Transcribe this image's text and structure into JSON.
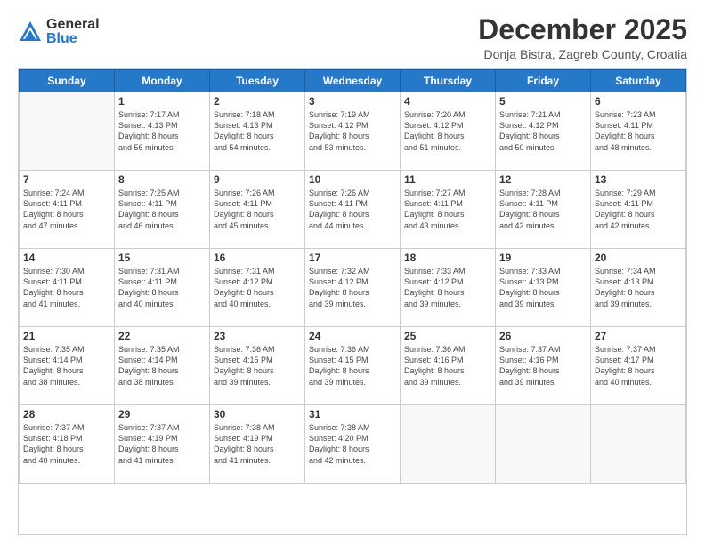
{
  "logo": {
    "general": "General",
    "blue": "Blue"
  },
  "header": {
    "month": "December 2025",
    "location": "Donja Bistra, Zagreb County, Croatia"
  },
  "days": [
    "Sunday",
    "Monday",
    "Tuesday",
    "Wednesday",
    "Thursday",
    "Friday",
    "Saturday"
  ],
  "weeks": [
    [
      {
        "day": "",
        "info": []
      },
      {
        "day": "1",
        "info": [
          "Sunrise: 7:17 AM",
          "Sunset: 4:13 PM",
          "Daylight: 8 hours",
          "and 56 minutes."
        ]
      },
      {
        "day": "2",
        "info": [
          "Sunrise: 7:18 AM",
          "Sunset: 4:13 PM",
          "Daylight: 8 hours",
          "and 54 minutes."
        ]
      },
      {
        "day": "3",
        "info": [
          "Sunrise: 7:19 AM",
          "Sunset: 4:12 PM",
          "Daylight: 8 hours",
          "and 53 minutes."
        ]
      },
      {
        "day": "4",
        "info": [
          "Sunrise: 7:20 AM",
          "Sunset: 4:12 PM",
          "Daylight: 8 hours",
          "and 51 minutes."
        ]
      },
      {
        "day": "5",
        "info": [
          "Sunrise: 7:21 AM",
          "Sunset: 4:12 PM",
          "Daylight: 8 hours",
          "and 50 minutes."
        ]
      },
      {
        "day": "6",
        "info": [
          "Sunrise: 7:23 AM",
          "Sunset: 4:11 PM",
          "Daylight: 8 hours",
          "and 48 minutes."
        ]
      }
    ],
    [
      {
        "day": "7",
        "info": [
          "Sunrise: 7:24 AM",
          "Sunset: 4:11 PM",
          "Daylight: 8 hours",
          "and 47 minutes."
        ]
      },
      {
        "day": "8",
        "info": [
          "Sunrise: 7:25 AM",
          "Sunset: 4:11 PM",
          "Daylight: 8 hours",
          "and 46 minutes."
        ]
      },
      {
        "day": "9",
        "info": [
          "Sunrise: 7:26 AM",
          "Sunset: 4:11 PM",
          "Daylight: 8 hours",
          "and 45 minutes."
        ]
      },
      {
        "day": "10",
        "info": [
          "Sunrise: 7:26 AM",
          "Sunset: 4:11 PM",
          "Daylight: 8 hours",
          "and 44 minutes."
        ]
      },
      {
        "day": "11",
        "info": [
          "Sunrise: 7:27 AM",
          "Sunset: 4:11 PM",
          "Daylight: 8 hours",
          "and 43 minutes."
        ]
      },
      {
        "day": "12",
        "info": [
          "Sunrise: 7:28 AM",
          "Sunset: 4:11 PM",
          "Daylight: 8 hours",
          "and 42 minutes."
        ]
      },
      {
        "day": "13",
        "info": [
          "Sunrise: 7:29 AM",
          "Sunset: 4:11 PM",
          "Daylight: 8 hours",
          "and 42 minutes."
        ]
      }
    ],
    [
      {
        "day": "14",
        "info": [
          "Sunrise: 7:30 AM",
          "Sunset: 4:11 PM",
          "Daylight: 8 hours",
          "and 41 minutes."
        ]
      },
      {
        "day": "15",
        "info": [
          "Sunrise: 7:31 AM",
          "Sunset: 4:11 PM",
          "Daylight: 8 hours",
          "and 40 minutes."
        ]
      },
      {
        "day": "16",
        "info": [
          "Sunrise: 7:31 AM",
          "Sunset: 4:12 PM",
          "Daylight: 8 hours",
          "and 40 minutes."
        ]
      },
      {
        "day": "17",
        "info": [
          "Sunrise: 7:32 AM",
          "Sunset: 4:12 PM",
          "Daylight: 8 hours",
          "and 39 minutes."
        ]
      },
      {
        "day": "18",
        "info": [
          "Sunrise: 7:33 AM",
          "Sunset: 4:12 PM",
          "Daylight: 8 hours",
          "and 39 minutes."
        ]
      },
      {
        "day": "19",
        "info": [
          "Sunrise: 7:33 AM",
          "Sunset: 4:13 PM",
          "Daylight: 8 hours",
          "and 39 minutes."
        ]
      },
      {
        "day": "20",
        "info": [
          "Sunrise: 7:34 AM",
          "Sunset: 4:13 PM",
          "Daylight: 8 hours",
          "and 39 minutes."
        ]
      }
    ],
    [
      {
        "day": "21",
        "info": [
          "Sunrise: 7:35 AM",
          "Sunset: 4:14 PM",
          "Daylight: 8 hours",
          "and 38 minutes."
        ]
      },
      {
        "day": "22",
        "info": [
          "Sunrise: 7:35 AM",
          "Sunset: 4:14 PM",
          "Daylight: 8 hours",
          "and 38 minutes."
        ]
      },
      {
        "day": "23",
        "info": [
          "Sunrise: 7:36 AM",
          "Sunset: 4:15 PM",
          "Daylight: 8 hours",
          "and 39 minutes."
        ]
      },
      {
        "day": "24",
        "info": [
          "Sunrise: 7:36 AM",
          "Sunset: 4:15 PM",
          "Daylight: 8 hours",
          "and 39 minutes."
        ]
      },
      {
        "day": "25",
        "info": [
          "Sunrise: 7:36 AM",
          "Sunset: 4:16 PM",
          "Daylight: 8 hours",
          "and 39 minutes."
        ]
      },
      {
        "day": "26",
        "info": [
          "Sunrise: 7:37 AM",
          "Sunset: 4:16 PM",
          "Daylight: 8 hours",
          "and 39 minutes."
        ]
      },
      {
        "day": "27",
        "info": [
          "Sunrise: 7:37 AM",
          "Sunset: 4:17 PM",
          "Daylight: 8 hours",
          "and 40 minutes."
        ]
      }
    ],
    [
      {
        "day": "28",
        "info": [
          "Sunrise: 7:37 AM",
          "Sunset: 4:18 PM",
          "Daylight: 8 hours",
          "and 40 minutes."
        ]
      },
      {
        "day": "29",
        "info": [
          "Sunrise: 7:37 AM",
          "Sunset: 4:19 PM",
          "Daylight: 8 hours",
          "and 41 minutes."
        ]
      },
      {
        "day": "30",
        "info": [
          "Sunrise: 7:38 AM",
          "Sunset: 4:19 PM",
          "Daylight: 8 hours",
          "and 41 minutes."
        ]
      },
      {
        "day": "31",
        "info": [
          "Sunrise: 7:38 AM",
          "Sunset: 4:20 PM",
          "Daylight: 8 hours",
          "and 42 minutes."
        ]
      },
      {
        "day": "",
        "info": []
      },
      {
        "day": "",
        "info": []
      },
      {
        "day": "",
        "info": []
      }
    ]
  ]
}
